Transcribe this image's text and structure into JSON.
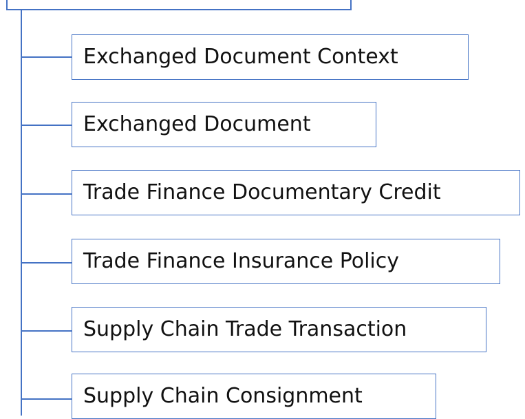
{
  "diagram": {
    "line_color": "#4472c4",
    "nodes": [
      {
        "label": "Exchanged Document Context"
      },
      {
        "label": "Exchanged Document"
      },
      {
        "label": "Trade Finance Documentary Credit"
      },
      {
        "label": "Trade Finance Insurance Policy"
      },
      {
        "label": "Supply Chain Trade Transaction"
      },
      {
        "label": "Supply Chain Consignment"
      }
    ]
  }
}
